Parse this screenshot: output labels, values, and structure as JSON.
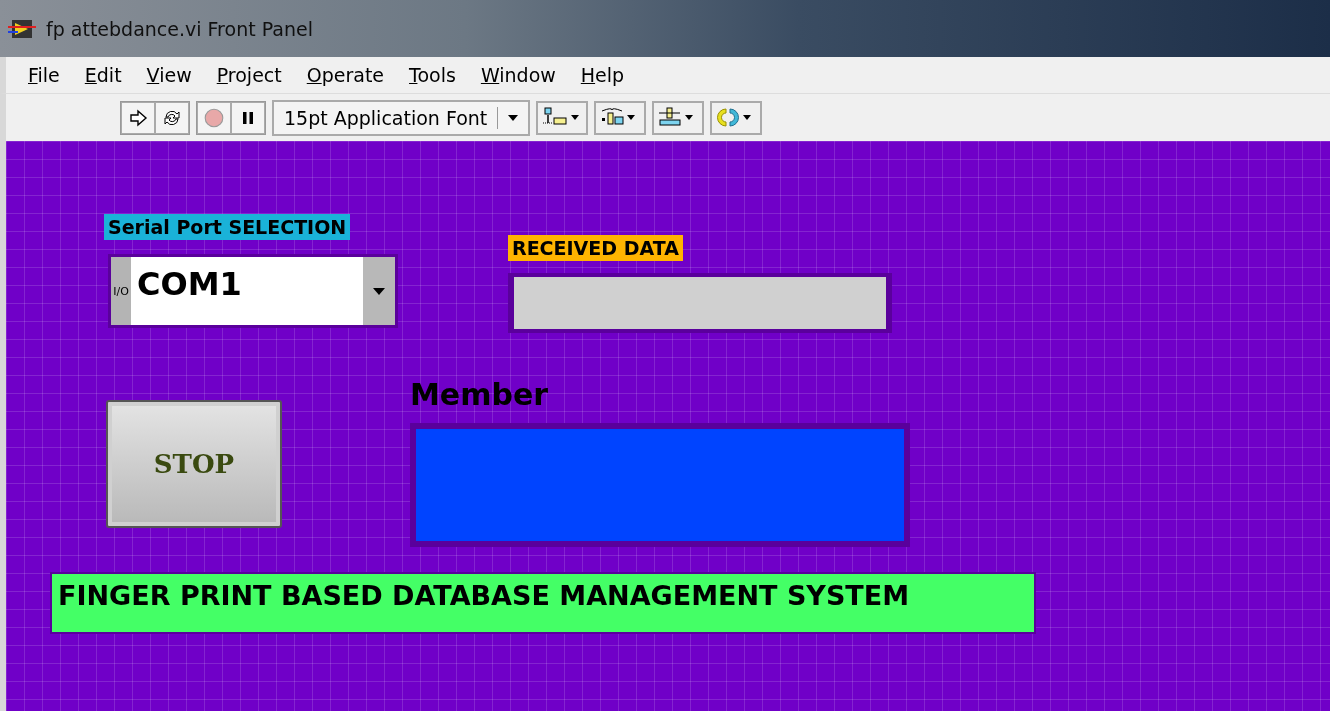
{
  "window": {
    "title": "fp attebdance.vi Front Panel"
  },
  "menu": [
    {
      "label": "File"
    },
    {
      "label": "Edit"
    },
    {
      "label": "View"
    },
    {
      "label": "Project"
    },
    {
      "label": "Operate"
    },
    {
      "label": "Tools"
    },
    {
      "label": "Window"
    },
    {
      "label": "Help"
    }
  ],
  "toolbar": {
    "abort_disabled": true,
    "font": "15pt Application Font"
  },
  "panel": {
    "serial_port": {
      "label": "Serial Port SELECTION",
      "value": "COM1",
      "prefix": "I/O"
    },
    "received_data": {
      "label": "RECEIVED DATA"
    },
    "stop_button": {
      "label": "STOP"
    },
    "member": {
      "label": "Member"
    },
    "banner": {
      "text": "FINGER PRINT BASED DATABASE MANAGEMENT SYSTEM"
    }
  }
}
